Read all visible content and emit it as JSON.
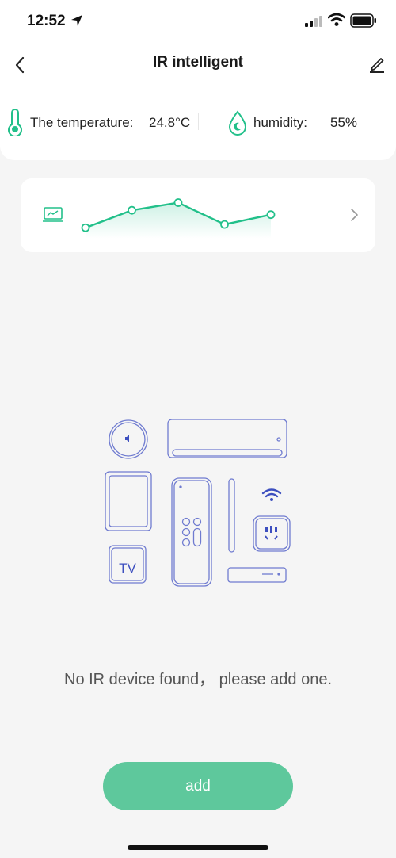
{
  "status_bar": {
    "time": "12:52"
  },
  "header": {
    "title": "IR intelligent"
  },
  "sensors": {
    "temperature_label": "The temperature:",
    "temperature_value": "24.8°C",
    "humidity_label": "humidity:",
    "humidity_value": "55%"
  },
  "chart_data": {
    "type": "line",
    "values": [
      10,
      26,
      33,
      13,
      22
    ],
    "ylim": [
      0,
      45
    ],
    "grid": false,
    "color": "#22c08a"
  },
  "empty_state": {
    "message": "No IR device found，  please add one."
  },
  "illustration": {
    "tv_label": "TV"
  },
  "actions": {
    "add_label": "add"
  },
  "colors": {
    "accent": "#22c08a",
    "button": "#5ec89c",
    "illustration": "#6f7bd0"
  }
}
